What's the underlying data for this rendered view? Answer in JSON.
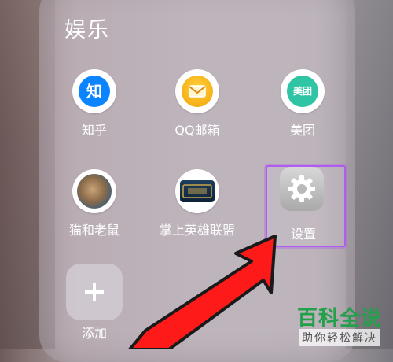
{
  "folder": {
    "title": "娱乐"
  },
  "apps": [
    {
      "label": "知乎",
      "icon": "zhihu-icon",
      "badge_text": "知",
      "color": "#0a84ff"
    },
    {
      "label": "QQ邮箱",
      "icon": "qq-mail-icon",
      "color": "#f2a10a"
    },
    {
      "label": "美团",
      "icon": "meituan-icon",
      "badge_text": "美团",
      "color": "#2fc4a4"
    },
    {
      "label": "猫和老鼠",
      "icon": "tom-and-jerry-icon"
    },
    {
      "label": "掌上英雄联盟",
      "icon": "lol-icon"
    },
    {
      "label": "设置",
      "icon": "settings-gear-icon"
    }
  ],
  "add": {
    "symbol": "+",
    "label": "添加"
  },
  "highlight_color": "#b15cf0",
  "watermark": {
    "title": "百科全说",
    "subtitle": "助你轻松解决"
  }
}
